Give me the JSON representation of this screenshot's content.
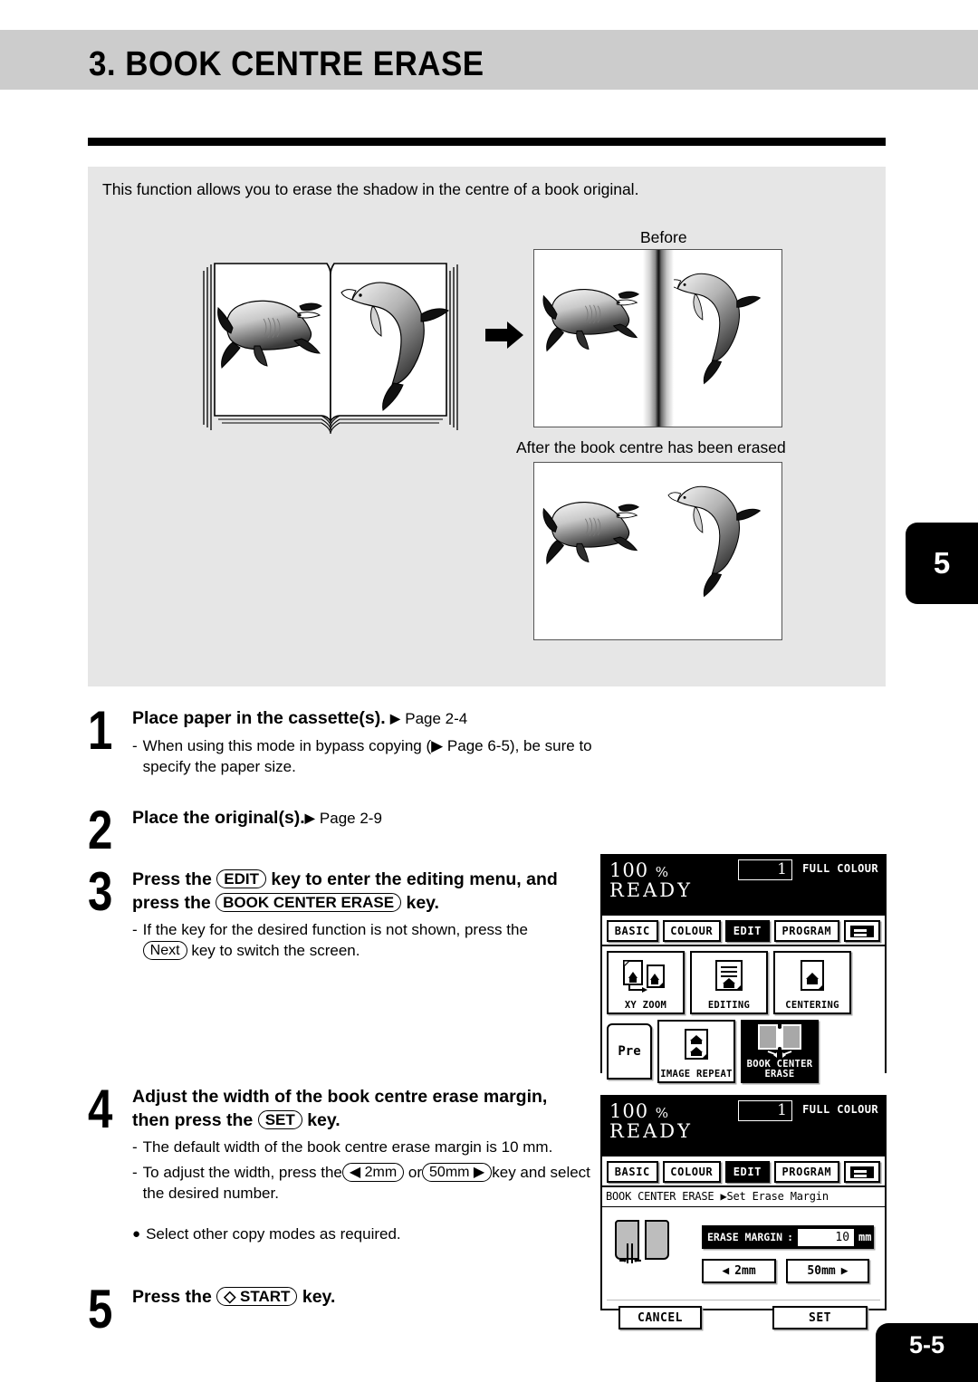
{
  "header": {
    "title": "3. BOOK CENTRE ERASE"
  },
  "intro": {
    "text": "This function allows you to erase the shadow in the centre of a book original."
  },
  "illustration": {
    "before_caption": "Before",
    "after_caption": "After the book centre has been erased",
    "arrow_icon": "arrow-right-icon",
    "book_icon": "open-book-icon"
  },
  "side_tab": {
    "chapter": "5"
  },
  "steps": [
    {
      "num": "1",
      "head_pre": "Place paper in the cassette(s).",
      "head_ref": "Page 2-4",
      "subs": [
        {
          "dash": "-",
          "text": "When using this mode in bypass copying (▶ Page 6-5), be sure to specify the paper size."
        }
      ]
    },
    {
      "num": "2",
      "head_pre": "Place the original(s).",
      "head_ref": "Page 2-9",
      "subs": []
    },
    {
      "num": "3",
      "head_line1_a": "Press the",
      "head_key1": "EDIT",
      "head_line1_b": "key to enter the editing menu, and",
      "head_line2_a": "press the",
      "head_key2": "BOOK CENTER ERASE",
      "head_line2_b": "key.",
      "subs": [
        {
          "dash": "-",
          "text_a": "If the key for the desired function is not shown, press the",
          "key": "Next",
          "text_b": "key to switch the screen."
        }
      ]
    },
    {
      "num": "4",
      "head_line1": "Adjust the width of the book centre erase margin,",
      "head_line2_a": "then press the",
      "head_key": "SET",
      "head_line2_b": "key.",
      "subs": [
        {
          "dash": "-",
          "text": "The default width of the book centre erase margin is 10 mm."
        },
        {
          "dash": "-",
          "text_a": "To adjust the width, press the",
          "key1": "◀ 2mm",
          "mid": "or",
          "key2": "50mm ▶",
          "text_b": "key and select the desired number."
        }
      ],
      "note": {
        "bullet": "●",
        "text": "Select other copy modes as required."
      }
    },
    {
      "num": "5",
      "head_a": "Press the",
      "head_key": "◇ START",
      "head_b": "key."
    }
  ],
  "lcd1": {
    "status": {
      "zoom": "100",
      "percent": "%",
      "copies": "1",
      "colour_mode": "FULL COLOUR",
      "state": "READY"
    },
    "tabs": [
      {
        "label": "BASIC",
        "selected": false
      },
      {
        "label": "COLOUR",
        "selected": false
      },
      {
        "label": "EDIT",
        "selected": true
      },
      {
        "label": "PROGRAM",
        "selected": false
      }
    ],
    "tab_icon": "keypad-icon",
    "functions": [
      {
        "label": "XY ZOOM",
        "icon": "xy-zoom-icon",
        "selected": false
      },
      {
        "label": "EDITING",
        "icon": "editing-icon",
        "selected": false
      },
      {
        "label": "CENTERING",
        "icon": "centering-icon",
        "selected": false
      },
      {
        "label": "IMAGE REPEAT",
        "icon": "image-repeat-icon",
        "selected": false
      },
      {
        "label": "BOOK CENTER",
        "label2": "ERASE",
        "icon": "book-center-erase-icon",
        "selected": true
      }
    ],
    "prev_button": {
      "label": "Pre"
    }
  },
  "lcd2": {
    "status": {
      "zoom": "100",
      "percent": "%",
      "copies": "1",
      "colour_mode": "FULL COLOUR",
      "state": "READY"
    },
    "tabs": [
      {
        "label": "BASIC",
        "selected": false
      },
      {
        "label": "COLOUR",
        "selected": false
      },
      {
        "label": "EDIT",
        "selected": true
      },
      {
        "label": "PROGRAM",
        "selected": false
      }
    ],
    "tab_icon": "keypad-icon",
    "breadcrumb": "BOOK CENTER ERASE ▶Set Erase Margin",
    "margin": {
      "label": "ERASE MARGIN",
      "colon": ":",
      "value": "10",
      "unit": "mm"
    },
    "adjust": {
      "decrease": "2mm",
      "increase": "50mm",
      "left_arrow": "◀",
      "right_arrow": "▶"
    },
    "footer": {
      "cancel": "CANCEL",
      "set": "SET"
    },
    "book_icon": "book-center-erase-icon"
  },
  "footer": {
    "page_number": "5-5"
  }
}
